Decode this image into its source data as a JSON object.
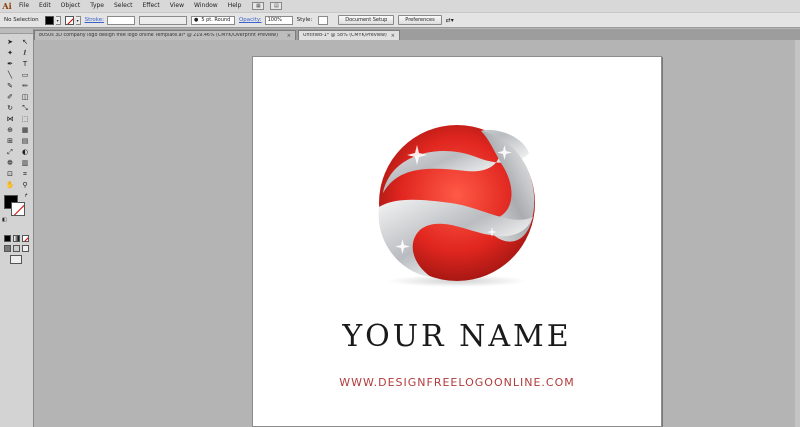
{
  "app": {
    "logo": "Ai"
  },
  "menu": [
    "File",
    "Edit",
    "Object",
    "Type",
    "Select",
    "Effect",
    "View",
    "Window",
    "Help"
  ],
  "controlbar": {
    "selection": "No Selection",
    "stroke_label": "Stroke:",
    "brush": "5 pt. Round",
    "opacity_label": "Opacity:",
    "opacity_value": "100%",
    "style_label": "Style:",
    "document_setup": "Document Setup",
    "preferences": "Preferences"
  },
  "tabs": [
    {
      "label": "8050s 3D company logo design free logo online Template.ai* @ 219.46% (CMYK/Overprint Preview)"
    },
    {
      "label": "Untitled-1* @ 58% (CMYK/Preview)"
    }
  ],
  "artboard": {
    "name": "YOUR NAME",
    "website": "WWW.DESIGNFREELOGOONLINE.COM"
  },
  "colors": {
    "logo_red": "#e0261f",
    "logo_silver": "#b9bcc0",
    "website_text": "#b23b3b"
  },
  "tools": [
    "selection-tool",
    "direct-selection-tool",
    "magic-wand-tool",
    "lasso-tool",
    "pen-tool",
    "type-tool",
    "line-tool",
    "rectangle-tool",
    "paintbrush-tool",
    "pencil-tool",
    "blob-brush-tool",
    "eraser-tool",
    "rotate-tool",
    "scale-tool",
    "width-tool",
    "free-transform-tool",
    "shape-builder-tool",
    "perspective-grid-tool",
    "mesh-tool",
    "gradient-tool",
    "eyedropper-tool",
    "blend-tool",
    "symbol-sprayer-tool",
    "column-graph-tool",
    "artboard-tool",
    "slice-tool",
    "hand-tool",
    "zoom-tool"
  ]
}
